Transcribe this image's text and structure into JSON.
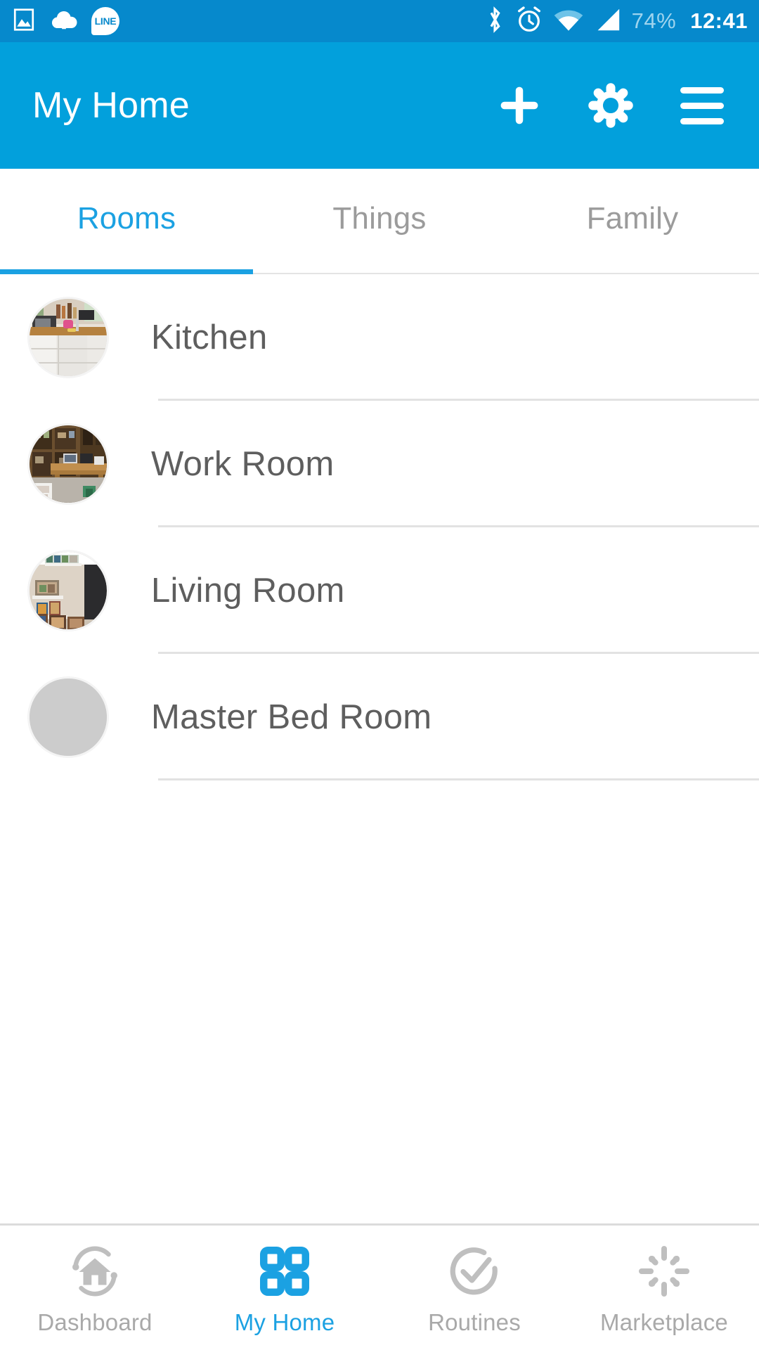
{
  "status_bar": {
    "left_icons": [
      "image-icon",
      "cloud-upload-icon",
      "line-app-icon"
    ],
    "line_label": "LINE",
    "right_icons": [
      "bluetooth-icon",
      "alarm-clock-icon",
      "wifi-icon",
      "cellular-signal-icon"
    ],
    "battery": "74%",
    "time": "12:41",
    "background_color": "#0689cc"
  },
  "app_bar": {
    "title": "My Home",
    "background_color": "#02a0dc",
    "actions": [
      {
        "name": "add-button",
        "icon": "plus-icon"
      },
      {
        "name": "settings-button",
        "icon": "gear-icon"
      },
      {
        "name": "menu-button",
        "icon": "hamburger-icon"
      }
    ]
  },
  "tabs": {
    "active_index": 0,
    "accent_color": "#1ba1e2",
    "items": [
      {
        "label": "Rooms"
      },
      {
        "label": "Things"
      },
      {
        "label": "Family"
      }
    ]
  },
  "rooms": [
    {
      "label": "Kitchen",
      "thumbnail": "kitchen-photo",
      "has_photo": true
    },
    {
      "label": "Work Room",
      "thumbnail": "work-room-photo",
      "has_photo": true
    },
    {
      "label": "Living Room",
      "thumbnail": "living-room-photo",
      "has_photo": true
    },
    {
      "label": "Master Bed Room",
      "thumbnail": "placeholder",
      "has_photo": false
    }
  ],
  "bottom_nav": {
    "active_index": 1,
    "active_color": "#1ba1e2",
    "inactive_color": "#a9a9a9",
    "items": [
      {
        "label": "Dashboard",
        "icon": "dashboard-home-sync-icon"
      },
      {
        "label": "My Home",
        "icon": "grid-squares-icon"
      },
      {
        "label": "Routines",
        "icon": "check-circle-icon"
      },
      {
        "label": "Marketplace",
        "icon": "burst-icon"
      }
    ]
  }
}
